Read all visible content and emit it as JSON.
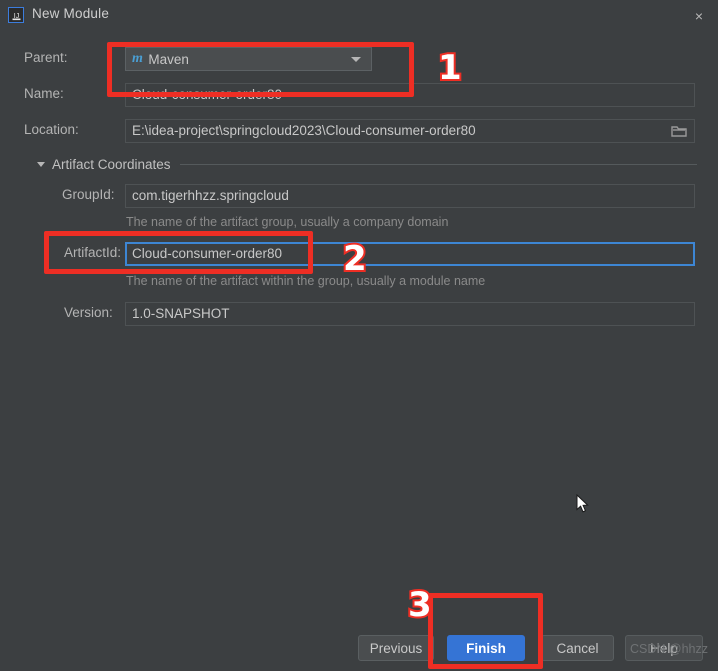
{
  "window": {
    "title": "New Module",
    "app_icon": "intellij-idea-icon",
    "close_label": "×"
  },
  "colors": {
    "background": "#3c3f41",
    "field_background": "#3c3f41",
    "field_border": "#4e5254",
    "focus_border": "#3d86d4",
    "primary_button": "#3574d5",
    "annotation_red": "#ee2e24",
    "maven_blue": "#4a9fd4",
    "text": "#bbbbbb",
    "hint_text": "#8a8a8a"
  },
  "form": {
    "parent": {
      "label": "Parent:",
      "icon": "maven-icon",
      "icon_glyph": "m",
      "value": "Maven",
      "options": [
        "Maven"
      ]
    },
    "name": {
      "label": "Name:",
      "value": "Cloud-consumer-order80"
    },
    "location": {
      "label": "Location:",
      "value": "E:\\idea-project\\springcloud2023\\Cloud-consumer-order80",
      "browse_icon": "folder-icon"
    }
  },
  "artifact_section": {
    "title": "Artifact Coordinates",
    "expanded": true,
    "fields": {
      "group_id": {
        "label": "GroupId:",
        "value": "com.tigerhhzz.springcloud",
        "hint": "The name of the artifact group, usually a company domain"
      },
      "artifact_id": {
        "label": "ArtifactId:",
        "value": "Cloud-consumer-order80",
        "hint": "The name of the artifact within the group, usually a module name",
        "focused": true
      },
      "version": {
        "label": "Version:",
        "value": "1.0-SNAPSHOT"
      }
    }
  },
  "buttons": {
    "previous": "Previous",
    "finish": "Finish",
    "cancel": "Cancel",
    "help": "Help"
  },
  "annotations": [
    {
      "number": "1",
      "target": "parent-combo"
    },
    {
      "number": "2",
      "target": "artifact-id-field"
    },
    {
      "number": "3",
      "target": "finish-button"
    }
  ],
  "watermark": "CSDN @hhzz"
}
